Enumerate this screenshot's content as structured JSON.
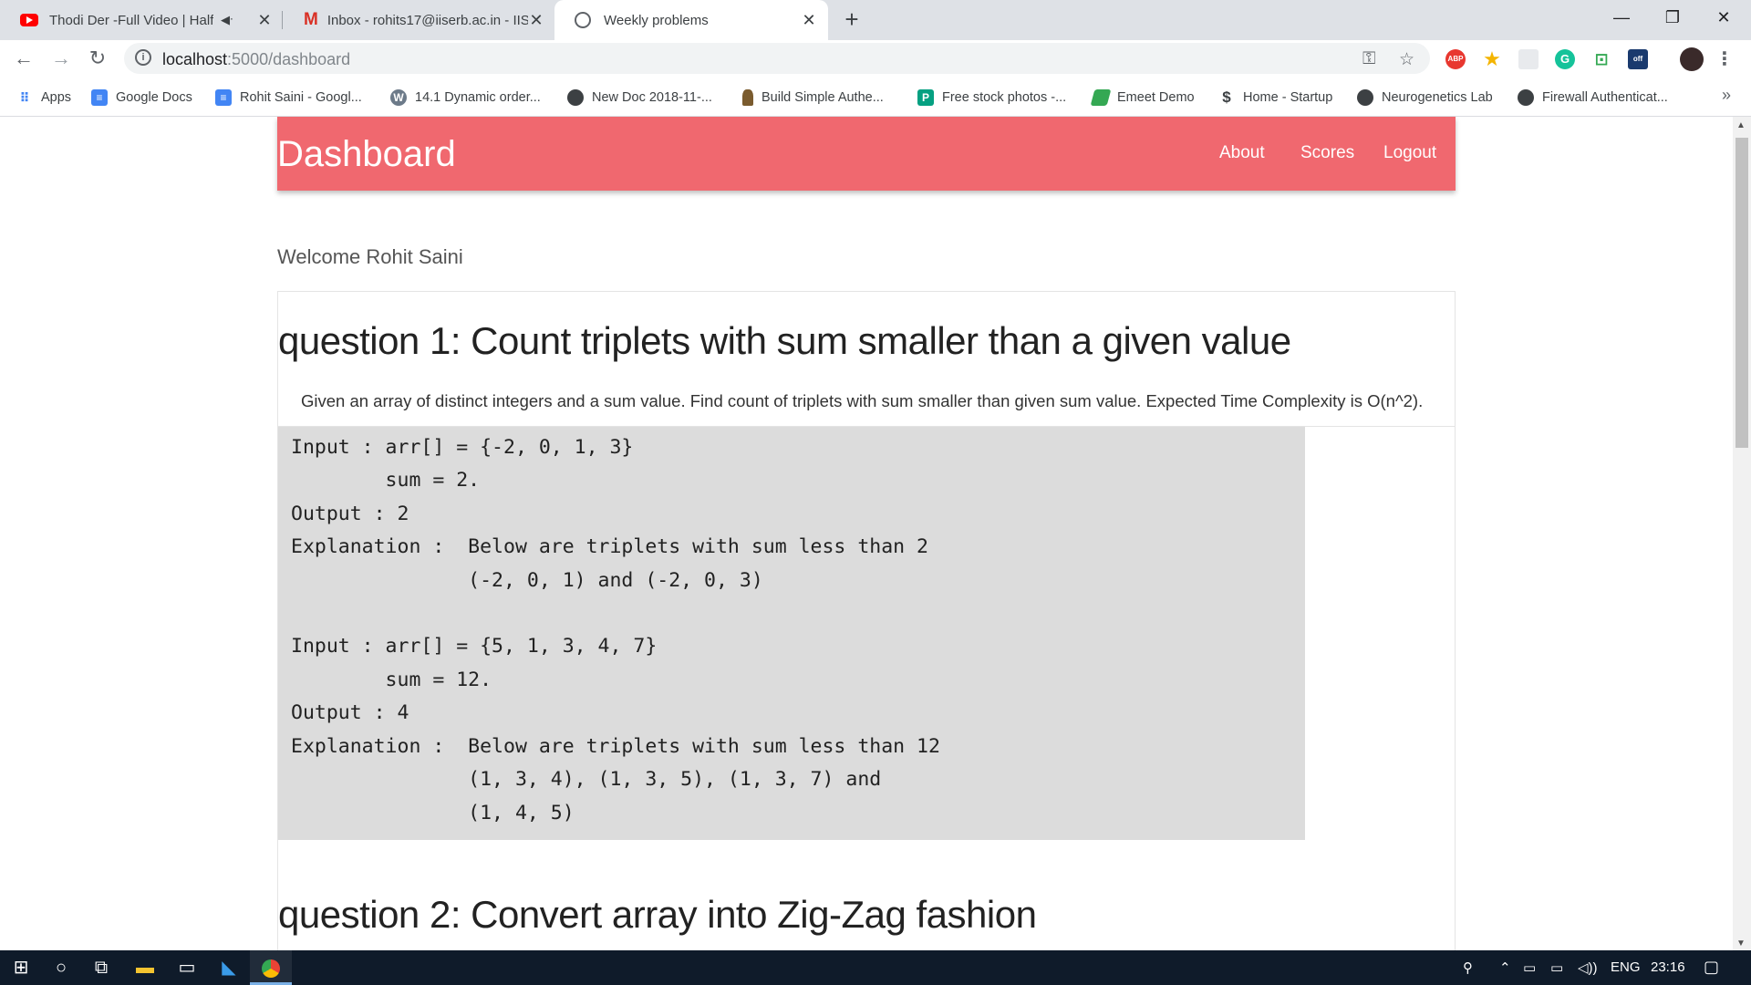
{
  "browser": {
    "tabs": [
      {
        "title": "Thodi Der -Full Video | Half G",
        "icon": "youtube-icon",
        "extra": "speaker-icon"
      },
      {
        "title": "Inbox - rohits17@iiserb.ac.in - IIS",
        "icon": "gmail-icon"
      },
      {
        "title": "Weekly problems",
        "icon": "globe-icon"
      }
    ],
    "url_host": "localhost",
    "url_path": ":5000/dashboard",
    "bookmarks": [
      {
        "label": "Apps",
        "icon": "apps-grid-icon",
        "color": "#ea4335"
      },
      {
        "label": "Google Docs",
        "icon": "docs-icon",
        "color": "#4285f4"
      },
      {
        "label": "Rohit Saini - Googl...",
        "icon": "docs-icon",
        "color": "#4285f4"
      },
      {
        "label": "14.1 Dynamic order...",
        "icon": "w-icon",
        "color": "#607080"
      },
      {
        "label": "New Doc 2018-11-...",
        "icon": "globe-icon",
        "color": "#3c4043"
      },
      {
        "label": "Build Simple Authe...",
        "icon": "figure-icon",
        "color": "#7a5b2e"
      },
      {
        "label": "Free stock photos -...",
        "icon": "photo-icon",
        "color": "#05a081"
      },
      {
        "label": "Emeet Demo",
        "icon": "leaf-icon",
        "color": "#34a853"
      },
      {
        "label": "Home - Startup",
        "icon": "dollar-icon",
        "color": "#3c4043"
      },
      {
        "label": "Neurogenetics Lab",
        "icon": "globe-icon",
        "color": "#3c4043"
      },
      {
        "label": "Firewall Authenticat...",
        "icon": "globe-icon",
        "color": "#3c4043"
      }
    ],
    "bookmarks_more": "»"
  },
  "page": {
    "brand": "Dashboard",
    "nav": [
      "About",
      "Scores",
      "Logout"
    ],
    "welcome": "Welcome Rohit Saini",
    "accent_color": "#f0686f",
    "questions": [
      {
        "title": "question 1: Count triplets with sum smaller than a given value",
        "description": "Given an array of distinct integers and a sum value. Find count of triplets with sum smaller than given sum value. Expected Time Complexity is O(n^2).",
        "example_lines": [
          "Input : arr[] = {-2, 0, 1, 3}",
          "        sum = 2.",
          "Output : 2",
          "Explanation :  Below are triplets with sum less than 2",
          "               (-2, 0, 1) and (-2, 0, 3)",
          "",
          "Input : arr[] = {5, 1, 3, 4, 7}",
          "        sum = 12.",
          "Output : 4",
          "Explanation :  Below are triplets with sum less than 12",
          "               (1, 3, 4), (1, 3, 5), (1, 3, 7) and",
          "               (1, 4, 5)"
        ]
      },
      {
        "title": "question 2: Convert array into Zig-Zag fashion"
      }
    ]
  },
  "taskbar": {
    "language": "ENG",
    "time": "23:16"
  }
}
